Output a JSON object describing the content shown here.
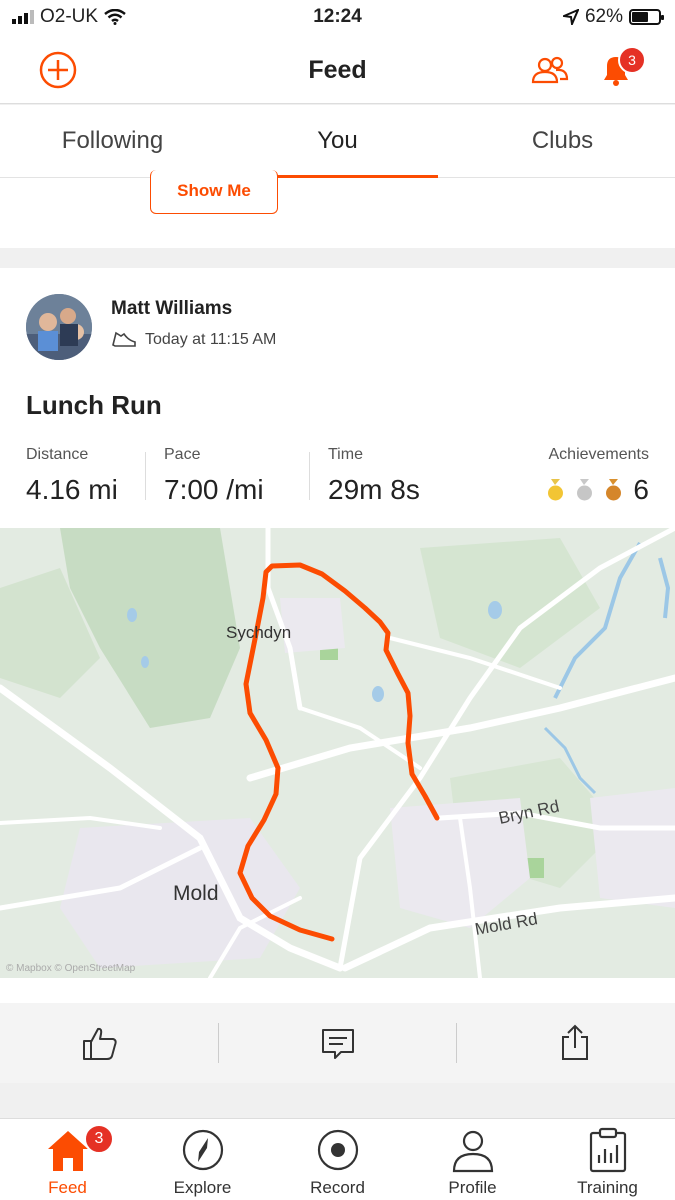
{
  "status": {
    "carrier": "O2-UK",
    "time": "12:24",
    "battery": "62%",
    "battery_level": 0.62
  },
  "header": {
    "title": "Feed",
    "notification_count": "3"
  },
  "tabs": [
    "Following",
    "You",
    "Clubs"
  ],
  "promo": {
    "button": "Show Me"
  },
  "activity": {
    "athlete": "Matt Williams",
    "time": "Today at 11:15 AM",
    "title": "Lunch Run",
    "stats": {
      "distance_label": "Distance",
      "distance": "4.16 mi",
      "pace_label": "Pace",
      "pace": "7:00 /mi",
      "time_label": "Time",
      "time": "29m 8s",
      "achievements_label": "Achievements",
      "achievements": "6"
    },
    "map": {
      "labels": [
        "Sychdyn",
        "Mold",
        "Bryn Rd",
        "Mold Rd"
      ],
      "attribution": "© Mapbox © OpenStreetMap"
    }
  },
  "colors": {
    "accent": "#fc4c02",
    "badge": "#e53125"
  },
  "tabbar": {
    "items": [
      "Feed",
      "Explore",
      "Record",
      "Profile",
      "Training"
    ],
    "feed_badge": "3"
  }
}
